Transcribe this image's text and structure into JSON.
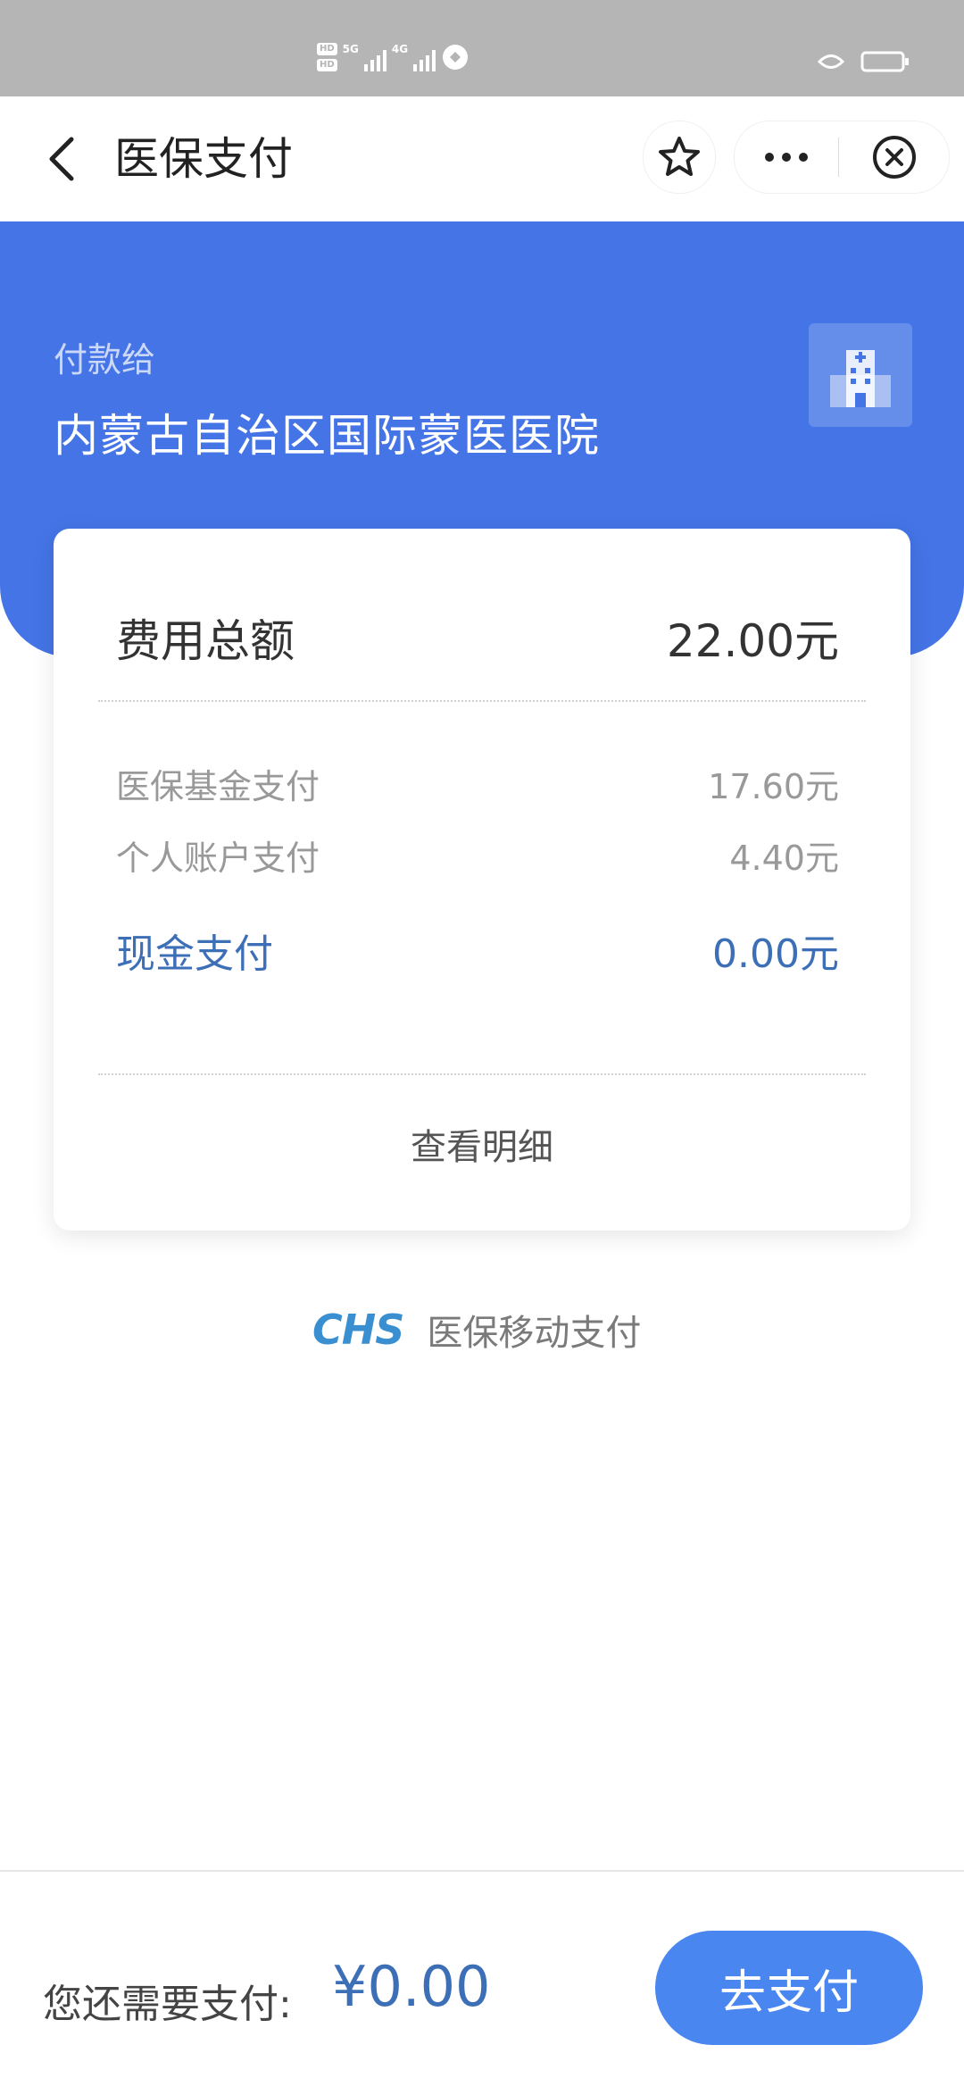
{
  "status_bar": {
    "hd1": "HD",
    "hd2": "HD",
    "net1": "5G",
    "net2": "4G"
  },
  "header": {
    "title": "医保支付"
  },
  "payee": {
    "label": "付款给",
    "name": "内蒙古自治区国际蒙医医院"
  },
  "summary": {
    "total_label": "费用总额",
    "total_value": "22.00元",
    "rows": [
      {
        "label": "医保基金支付",
        "value": "17.60元"
      },
      {
        "label": "个人账户支付",
        "value": "4.40元"
      }
    ],
    "cash_label": "现金支付",
    "cash_value": "0.00元",
    "details_link": "查看明细"
  },
  "brand": {
    "logo": "CHS",
    "text": "医保移动支付"
  },
  "footer": {
    "remaining_label": "您还需要支付:",
    "remaining_amount": "¥0.00",
    "pay_button": "去支付"
  },
  "colors": {
    "hero_blue": "#4474e6",
    "accent_blue": "#3d6fb7",
    "button_blue": "#4a86f0"
  },
  "icons": [
    "back-arrow-icon",
    "star-icon",
    "more-dots-icon",
    "close-circle-icon",
    "hospital-icon"
  ]
}
